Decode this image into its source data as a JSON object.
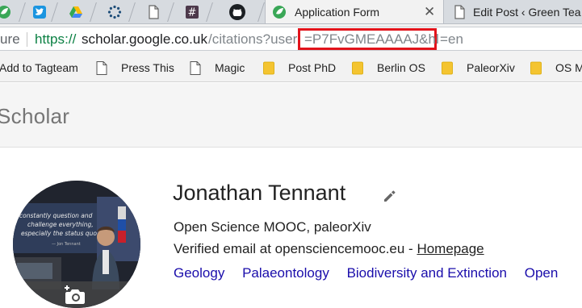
{
  "colors": {
    "tabstrip_bg": "#d7dbe0",
    "secure_green": "#0b8043",
    "highlight_box": "#e2131b",
    "link_blue": "#1a0dab",
    "folder_yellow": "#f4c430"
  },
  "tabs": [
    {
      "icon": "green-leaf-icon"
    },
    {
      "icon": "twitter-bird-icon"
    },
    {
      "icon": "google-drive-icon"
    },
    {
      "icon": "loading-spinner-icon"
    },
    {
      "icon": "blank-page-icon"
    },
    {
      "icon": "slack-hash-icon"
    },
    {
      "icon": "github-icon"
    },
    {
      "icon": "green-leaf-icon",
      "title": "Application Form",
      "active": true,
      "close": "✕"
    },
    {
      "icon": "blank-page-icon",
      "title": "Edit Post ‹ Green Tea"
    }
  ],
  "omnibox": {
    "secure_label": "ure",
    "scheme": "https://",
    "host": "scholar.google.co.uk",
    "path": "/citations?user",
    "highlighted": "=P7FvGMEAAAAJ&hl",
    "tail": "=en"
  },
  "bookmarks": [
    {
      "label": "Add to Tagteam",
      "icon": "none"
    },
    {
      "label": "Press This",
      "icon": "page-icon"
    },
    {
      "label": "Magic",
      "icon": "page-icon"
    },
    {
      "label": "Post PhD",
      "icon": "folder-icon"
    },
    {
      "label": "Berlin OS",
      "icon": "folder-icon"
    },
    {
      "label": "PaleorXiv",
      "icon": "folder-icon"
    },
    {
      "label": "OS M",
      "icon": "folder-icon"
    }
  ],
  "scholar": {
    "logo_text": "Scholar"
  },
  "profile": {
    "name": "Jonathan Tennant",
    "affiliation": "Open Science MOOC, paleorXiv",
    "verified_prefix": "Verified email at opensciencemooc.eu - ",
    "homepage_label": "Homepage",
    "interests": [
      "Geology",
      "Palaeontology",
      "Biodiversity and Extinction",
      "Open"
    ],
    "photo_caption_lines": [
      "constantly question and",
      "challenge everything,",
      "especially the status quo.",
      "— Jon Tennant"
    ]
  }
}
